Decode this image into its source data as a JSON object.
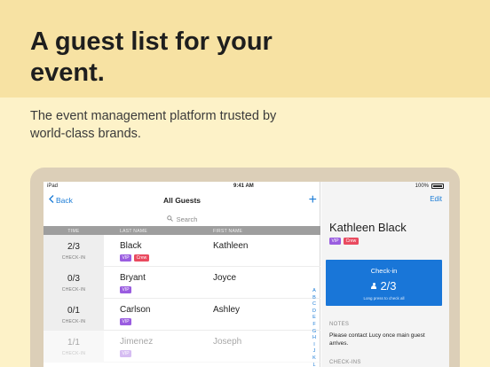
{
  "hero": {
    "title": "A guest list for your event.",
    "subtitle": "The event management platform trusted by world-class brands."
  },
  "statusbar": {
    "left": "iPad",
    "time": "9:41 AM",
    "battery": "100%"
  },
  "nav": {
    "back_label": "Back",
    "title": "All Guests",
    "add_label": "+"
  },
  "search": {
    "placeholder": "Search"
  },
  "table": {
    "headers": {
      "time": "TIME",
      "last": "LAST NAME",
      "first": "FIRST NAME"
    },
    "rows": [
      {
        "count": "2/3",
        "count_label": "CHECK-IN",
        "last": "Black",
        "first": "Kathleen",
        "tags": [
          "VIP",
          "Crew"
        ]
      },
      {
        "count": "0/3",
        "count_label": "CHECK-IN",
        "last": "Bryant",
        "first": "Joyce",
        "tags": [
          "VIP"
        ]
      },
      {
        "count": "0/1",
        "count_label": "CHECK-IN",
        "last": "Carlson",
        "first": "Ashley",
        "tags": [
          "VIP"
        ]
      },
      {
        "count": "1/1",
        "count_label": "CHECK-IN",
        "last": "Jimenez",
        "first": "Joseph",
        "tags": [
          "VIP"
        ]
      }
    ]
  },
  "index_letters": [
    "A",
    "B",
    "C",
    "D",
    "E",
    "F",
    "G",
    "H",
    "I",
    "J",
    "K",
    "L",
    "M",
    "N"
  ],
  "detail": {
    "edit_label": "Edit",
    "name": "Kathleen Black",
    "tags": [
      "VIP",
      "Crew"
    ],
    "checkin": {
      "title": "Check-in",
      "count": "2/3",
      "hint": "Long press to check all"
    },
    "notes_label": "NOTES",
    "notes_text": "Please contact Lucy once main guest arrives.",
    "checkins_label": "CHECK-INS"
  },
  "colors": {
    "accent": "#1a7bd6",
    "vip": "#9a5de0",
    "crew": "#e94a5f",
    "hero_bg": "#f7e2a3",
    "page_bg": "#fdf2c8"
  }
}
